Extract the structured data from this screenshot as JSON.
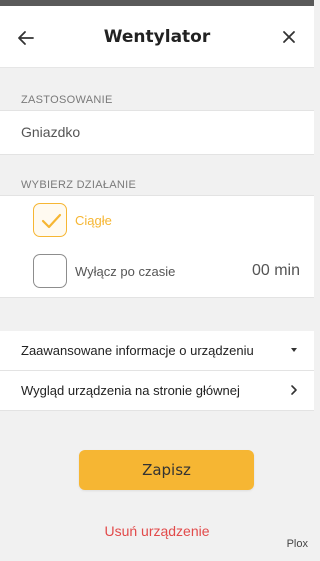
{
  "header": {
    "title": "Wentylator",
    "back_icon": "arrow-left-icon",
    "close_icon": "close-icon"
  },
  "usage": {
    "label": "ZASTOSOWANIE",
    "value": "Gniazdko"
  },
  "action": {
    "label": "WYBIERZ DZIAŁANIE",
    "options": [
      {
        "label": "Ciągłe",
        "checked": true
      },
      {
        "label": "Wyłącz po czasie",
        "checked": false,
        "value": "00 min"
      }
    ]
  },
  "links": [
    {
      "label": "Zaawansowane informacje o urządzeniu",
      "icon": "caret-down-icon"
    },
    {
      "label": "Wygląd urządzenia na stronie głównej",
      "icon": "chevron-right-icon"
    }
  ],
  "save_label": "Zapisz",
  "delete_label": "Usuń urządzenie",
  "brand": "Plox",
  "colors": {
    "accent": "#f6b633",
    "danger": "#e24a4a",
    "background": "#f1f1f1"
  }
}
